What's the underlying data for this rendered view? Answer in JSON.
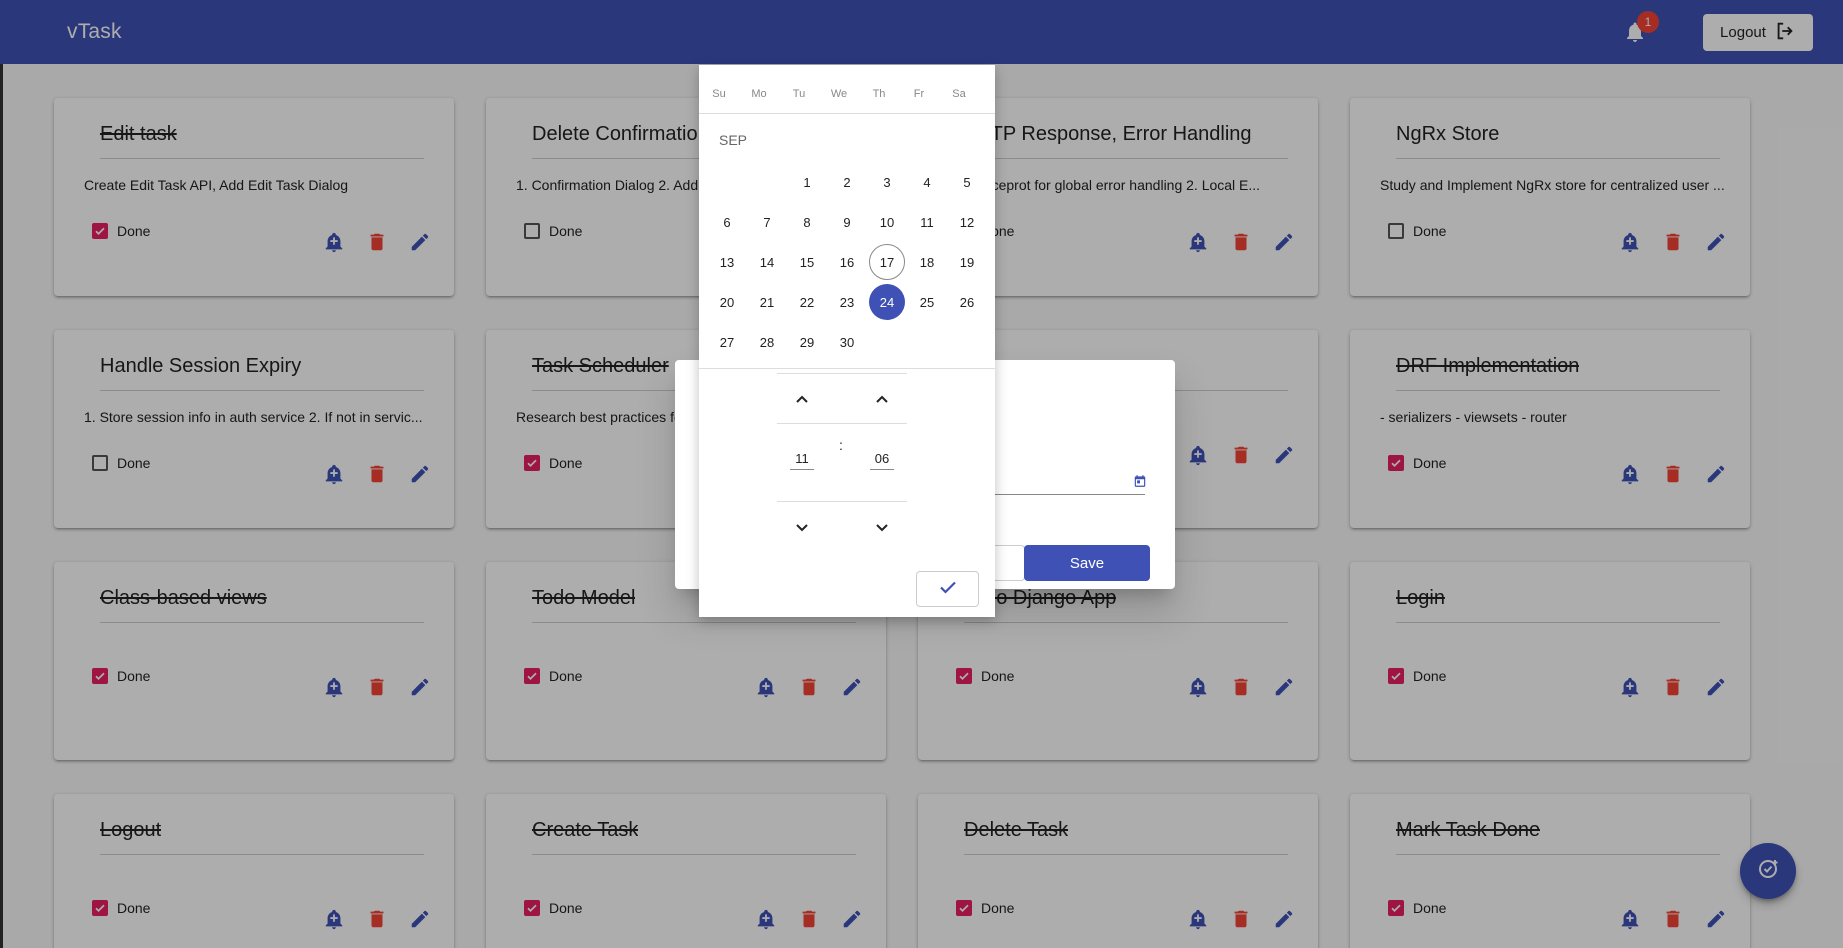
{
  "app": {
    "title": "vTask",
    "notification_count": "1",
    "logout_label": "Logout"
  },
  "colors": {
    "primary": "#3f51b5",
    "accent": "#e91e63",
    "warn": "#f44336"
  },
  "cards": [
    {
      "title": "Edit task",
      "description": "Create Edit Task API, Add Edit Task Dialog",
      "done": true
    },
    {
      "title": "Delete Confirmation Dialog",
      "description": "1. Confirmation Dialog 2. Add",
      "done": false
    },
    {
      "title": "HTTP Response, Error Handling",
      "description": "1. Interceprot for global error handling 2. Local E...",
      "done": false
    },
    {
      "title": "NgRx Store",
      "description": "Study and Implement NgRx store for centralized user ...",
      "done": false
    },
    {
      "title": "Handle Session Expiry",
      "description": "1. Store session info in auth service 2. If not in servic...",
      "done": false
    },
    {
      "title": "Task Scheduler",
      "description": "Research best practices for",
      "done": true
    },
    {
      "title": "",
      "description": "",
      "done": false
    },
    {
      "title": "DRF Implementation",
      "description": "- serializers - viewsets - router",
      "done": true
    },
    {
      "title": "Class-based views",
      "description": "",
      "done": true
    },
    {
      "title": "Todo Model",
      "description": "",
      "done": true
    },
    {
      "title": "Todo Django App",
      "description": "",
      "done": true
    },
    {
      "title": "Login",
      "description": "",
      "done": true
    },
    {
      "title": "Logout",
      "description": "",
      "done": true
    },
    {
      "title": "Create Task",
      "description": "",
      "done": true
    },
    {
      "title": "Delete Task",
      "description": "",
      "done": true
    },
    {
      "title": "Mark Task Done",
      "description": "",
      "done": true
    }
  ],
  "done_label": "Done",
  "dialog": {
    "save_label": "Save"
  },
  "picker": {
    "weekdays": [
      "Su",
      "Mo",
      "Tu",
      "We",
      "Th",
      "Fr",
      "Sa"
    ],
    "month": "SEP",
    "days": [
      "1",
      "2",
      "3",
      "4",
      "5",
      "6",
      "7",
      "8",
      "9",
      "10",
      "11",
      "12",
      "13",
      "14",
      "15",
      "16",
      "17",
      "18",
      "19",
      "20",
      "21",
      "22",
      "23",
      "24",
      "25",
      "26",
      "27",
      "28",
      "29",
      "30"
    ],
    "first_weekday": 2,
    "today": "17",
    "selected": "24",
    "hour": "11",
    "minute": "06",
    "separator": ":"
  },
  "icons": {
    "notifications": "bell-icon",
    "logout": "logout-icon",
    "reminder": "add-alert-icon",
    "delete": "delete-icon",
    "edit": "edit-icon",
    "calendar": "calendar-icon",
    "confirm": "check-icon",
    "fab": "add-task-icon"
  }
}
